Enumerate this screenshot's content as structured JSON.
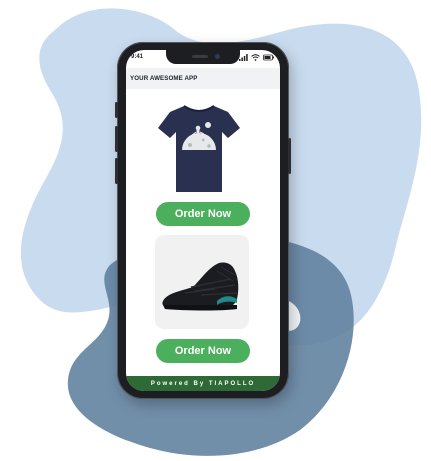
{
  "status_bar": {
    "time": "9:41"
  },
  "app": {
    "title": "YOUR AWESOME APP"
  },
  "products": [
    {
      "name": "tshirt",
      "order_label": "Order Now"
    },
    {
      "name": "sneaker",
      "order_label": "Order Now"
    }
  ],
  "footer": {
    "text": "Powered By TIAPOLLO"
  },
  "colors": {
    "order_button": "#4caf5d",
    "footer_bg": "#2e6a35",
    "blob_light": "#c9dcef",
    "blob_dark": "#5f7f9e"
  }
}
